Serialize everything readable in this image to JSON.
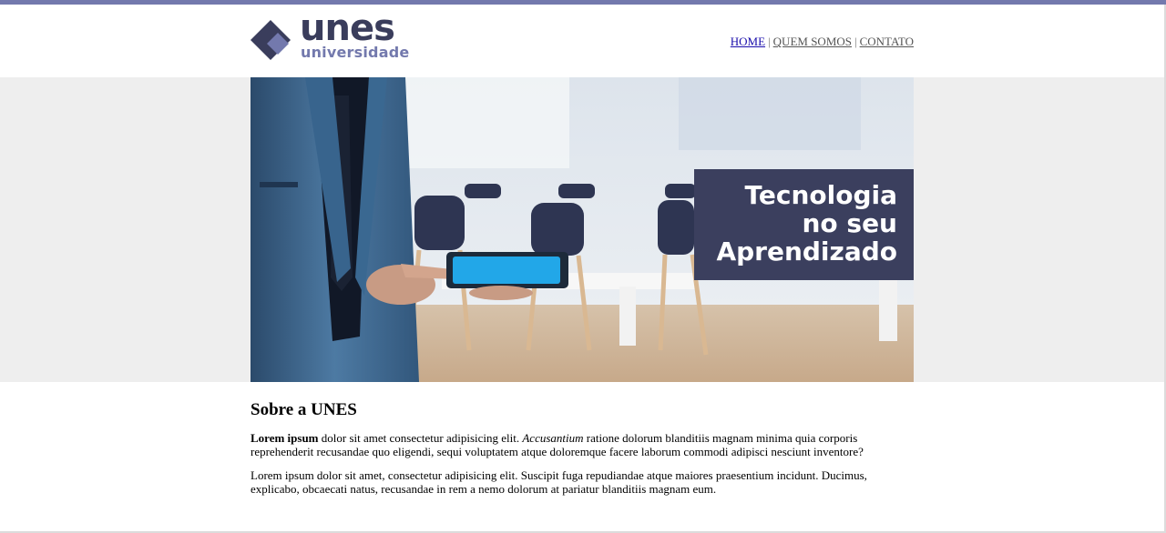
{
  "brand": {
    "name": "unes",
    "subtitle": "universidade",
    "colors": {
      "accent": "#7379ad",
      "dark": "#3a3d5c"
    }
  },
  "nav": {
    "items": [
      {
        "label": "HOME"
      },
      {
        "label": "QUEM SOMOS"
      },
      {
        "label": "CONTATO"
      }
    ],
    "separator": "|"
  },
  "banner": {
    "lines": [
      "Tecnologia",
      "no seu",
      "Aprendizado"
    ]
  },
  "about": {
    "title": "Sobre a UNES",
    "p1_bold": "Lorem ipsum",
    "p1_text_a": " dolor sit amet consectetur adipisicing elit. ",
    "p1_italic": "Accusantium",
    "p1_text_b": " ratione dolorum blanditiis magnam minima quia corporis reprehenderit recusandae quo eligendi, sequi voluptatem atque doloremque facere laborum commodi adipisci nesciunt inventore?",
    "p2": "Lorem ipsum dolor sit amet, consectetur adipisicing elit. Suscipit fuga repudiandae atque maiores praesentium incidunt. Ducimus, explicabo, obcaecati natus, recusandae in rem a nemo dolorum at pariatur blanditiis magnam eum."
  }
}
